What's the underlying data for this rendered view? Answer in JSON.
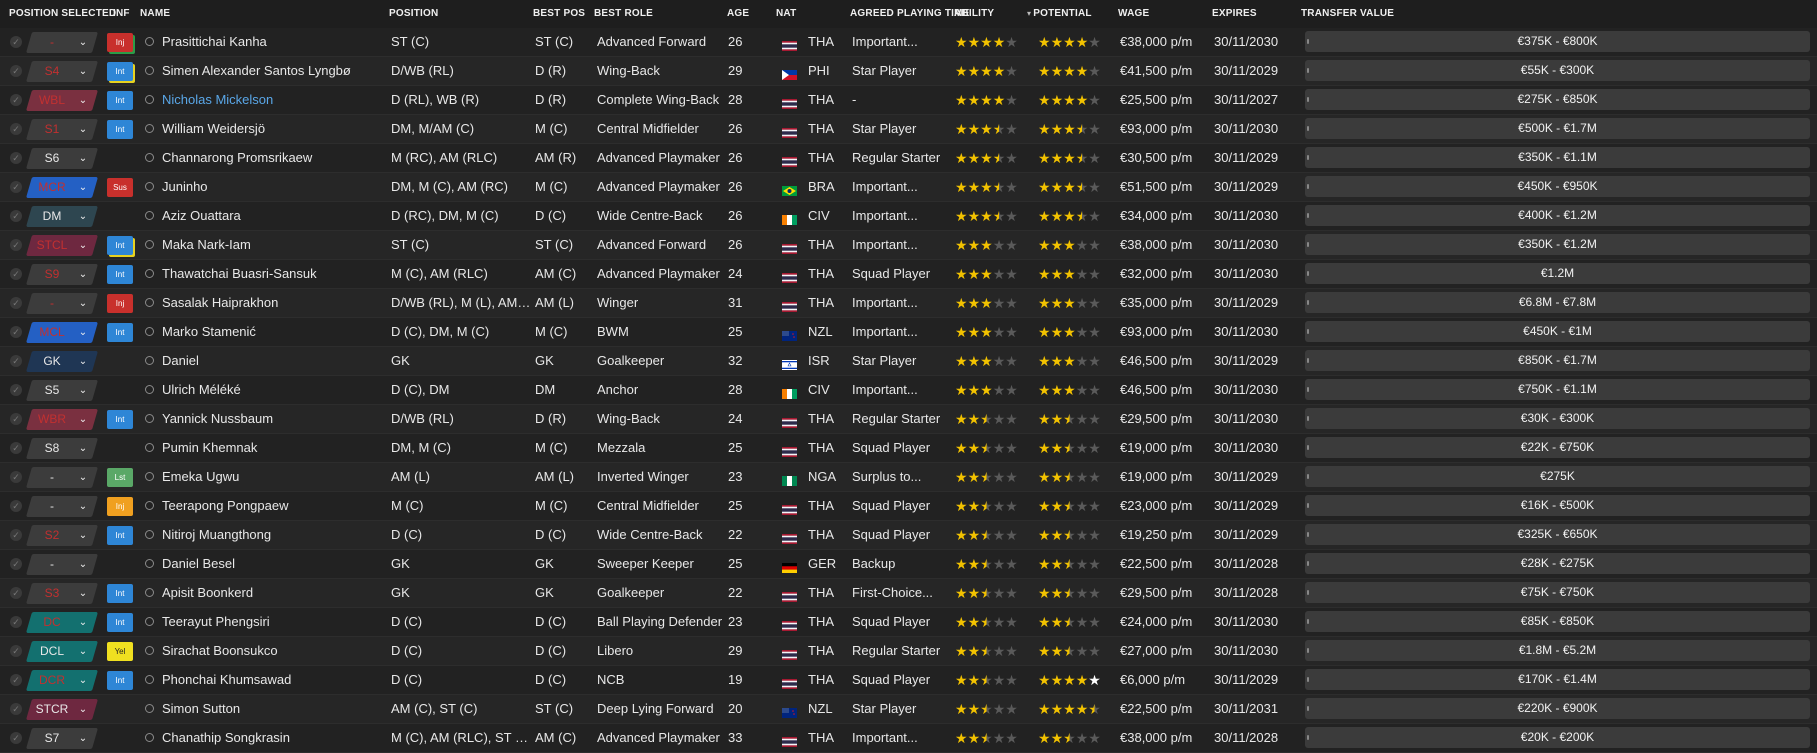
{
  "headers": {
    "position_selected": "POSITION SELECTED",
    "inf": "INF",
    "name": "NAME",
    "position": "POSITION",
    "best_pos": "BEST POS",
    "best_role": "BEST ROLE",
    "age": "AGE",
    "nat": "NAT",
    "agreed_playing_time": "AGREED PLAYING TIME",
    "ability": "ABILITY",
    "potential": "POTENTIAL",
    "wage": "WAGE",
    "expires": "EXPIRES",
    "transfer_value": "TRANSFER VALUE"
  },
  "sort": {
    "column": "potential",
    "direction": "descending",
    "indicator": "▾"
  },
  "colors": {
    "inj": "#c8302c",
    "int": "#2e86d6",
    "sus": "#c8302c",
    "lst": "#5aa867",
    "yel": "#f0e020",
    "inj_orange": "#f0a020",
    "gk": "#1f3654",
    "defence": "#13706f",
    "wing_back_red": "#7a3040",
    "midfield": "#3c4a52",
    "mid_blue": "#2460c4",
    "attack": "#7a2f4e",
    "striker": "#6e2840",
    "sub": "#3c3c3c",
    "star": "#f2c200"
  },
  "players": [
    {
      "sel": "-",
      "sel_color": "#3c3c3c",
      "sel_text_color": "#c23030",
      "badge": "Inj",
      "badge_color": "#c8302c",
      "badge_border": "#2a9d48",
      "name": "Prasittichai Kanha",
      "highlight": false,
      "position": "ST (C)",
      "best_pos": "ST (C)",
      "best_role": "Advanced Forward",
      "age": "26",
      "nat": "THA",
      "flag": "tha",
      "apt": "Important...",
      "ability": 4,
      "potential": 4,
      "wage": "€38,000 p/m",
      "expires": "30/11/2030",
      "tv": "€375K - €800K"
    },
    {
      "sel": "S4",
      "sel_color": "#3c3c3c",
      "sel_text_color": "#c23030",
      "badge": "Int",
      "badge_color": "#2e86d6",
      "badge_border": "#e8d21f",
      "name": "Simen Alexander Santos Lyngbø",
      "highlight": false,
      "position": "D/WB (RL)",
      "best_pos": "D (R)",
      "best_role": "Wing-Back",
      "age": "29",
      "nat": "PHI",
      "flag": "phi",
      "apt": "Star Player",
      "ability": 4,
      "potential": 4,
      "wage": "€41,500 p/m",
      "expires": "30/11/2029",
      "tv": "€55K - €300K"
    },
    {
      "sel": "WBL",
      "sel_color": "#7a3040",
      "sel_text_color": "#c23030",
      "badge": "Int",
      "badge_color": "#2e86d6",
      "badge_border": "",
      "name": "Nicholas Mickelson",
      "highlight": true,
      "position": "D (RL), WB (R)",
      "best_pos": "D (R)",
      "best_role": "Complete Wing-Back",
      "age": "28",
      "nat": "THA",
      "flag": "tha",
      "apt": "-",
      "ability": 4,
      "potential": 4,
      "wage": "€25,500 p/m",
      "expires": "30/11/2027",
      "tv": "€275K - €850K"
    },
    {
      "sel": "S1",
      "sel_color": "#3c3c3c",
      "sel_text_color": "#c23030",
      "badge": "Int",
      "badge_color": "#2e86d6",
      "badge_border": "",
      "name": "William Weidersjö",
      "highlight": false,
      "position": "DM, M/AM (C)",
      "best_pos": "M (C)",
      "best_role": "Central Midfielder",
      "age": "26",
      "nat": "THA",
      "flag": "tha",
      "apt": "Star Player",
      "ability": 3.5,
      "potential": 3.5,
      "wage": "€93,000 p/m",
      "expires": "30/11/2030",
      "tv": "€500K - €1.7M"
    },
    {
      "sel": "S6",
      "sel_color": "#3c3c3c",
      "sel_text_color": "#e8e8e8",
      "badge": "",
      "badge_color": "",
      "badge_border": "",
      "name": "Channarong Promsrikaew",
      "highlight": false,
      "position": "M (RC), AM (RLC)",
      "best_pos": "AM (R)",
      "best_role": "Advanced Playmaker",
      "age": "26",
      "nat": "THA",
      "flag": "tha",
      "apt": "Regular Starter",
      "ability": 3.5,
      "potential": 3.5,
      "wage": "€30,500 p/m",
      "expires": "30/11/2029",
      "tv": "€350K - €1.1M"
    },
    {
      "sel": "MCR",
      "sel_color": "#2460c4",
      "sel_text_color": "#c23030",
      "badge": "Sus",
      "badge_color": "#c8302c",
      "badge_border": "",
      "name": "Juninho",
      "highlight": false,
      "position": "DM, M (C), AM (RC)",
      "best_pos": "M (C)",
      "best_role": "Advanced Playmaker",
      "age": "26",
      "nat": "BRA",
      "flag": "bra",
      "apt": "Important...",
      "ability": 3.5,
      "potential": 3.5,
      "wage": "€51,500 p/m",
      "expires": "30/11/2029",
      "tv": "€450K - €950K"
    },
    {
      "sel": "DM",
      "sel_color": "#2e4650",
      "sel_text_color": "#e8e8e8",
      "badge": "",
      "badge_color": "",
      "badge_border": "",
      "name": "Aziz Ouattara",
      "highlight": false,
      "position": "D (RC), DM, M (C)",
      "best_pos": "D (C)",
      "best_role": "Wide Centre-Back",
      "age": "26",
      "nat": "CIV",
      "flag": "civ",
      "apt": "Important...",
      "ability": 3.5,
      "potential": 3.5,
      "wage": "€34,000 p/m",
      "expires": "30/11/2030",
      "tv": "€400K - €1.2M"
    },
    {
      "sel": "STCL",
      "sel_color": "#6e2840",
      "sel_text_color": "#c23030",
      "badge": "Int",
      "badge_color": "#2e86d6",
      "badge_border": "#e8d21f",
      "name": "Maka Nark-Iam",
      "highlight": false,
      "position": "ST (C)",
      "best_pos": "ST (C)",
      "best_role": "Advanced Forward",
      "age": "26",
      "nat": "THA",
      "flag": "tha",
      "apt": "Important...",
      "ability": 3,
      "potential": 3,
      "wage": "€38,000 p/m",
      "expires": "30/11/2030",
      "tv": "€350K - €1.2M"
    },
    {
      "sel": "S9",
      "sel_color": "#3c3c3c",
      "sel_text_color": "#c23030",
      "badge": "Int",
      "badge_color": "#2e86d6",
      "badge_border": "",
      "name": "Thawatchai Buasri-Sansuk",
      "highlight": false,
      "position": "M (C), AM (RLC)",
      "best_pos": "AM (C)",
      "best_role": "Advanced Playmaker",
      "age": "24",
      "nat": "THA",
      "flag": "tha",
      "apt": "Squad Player",
      "ability": 3,
      "potential": 3,
      "wage": "€32,000 p/m",
      "expires": "30/11/2030",
      "tv": "€1.2M"
    },
    {
      "sel": "-",
      "sel_color": "#3c3c3c",
      "sel_text_color": "#c23030",
      "badge": "Inj",
      "badge_color": "#c8302c",
      "badge_border": "",
      "name": "Sasalak Haiprakhon",
      "highlight": false,
      "position": "D/WB (RL), M (L), AM (R...",
      "best_pos": "AM (L)",
      "best_role": "Winger",
      "age": "31",
      "nat": "THA",
      "flag": "tha",
      "apt": "Important...",
      "ability": 3,
      "potential": 3,
      "wage": "€35,000 p/m",
      "expires": "30/11/2029",
      "tv": "€6.8M - €7.8M"
    },
    {
      "sel": "MCL",
      "sel_color": "#2460c4",
      "sel_text_color": "#c23030",
      "badge": "Int",
      "badge_color": "#2e86d6",
      "badge_border": "",
      "name": "Marko Stamenić",
      "highlight": false,
      "position": "D (C), DM, M (C)",
      "best_pos": "M (C)",
      "best_role": "BWM",
      "age": "25",
      "nat": "NZL",
      "flag": "nzl",
      "apt": "Important...",
      "ability": 3,
      "potential": 3,
      "wage": "€93,000 p/m",
      "expires": "30/11/2030",
      "tv": "€450K - €1M"
    },
    {
      "sel": "GK",
      "sel_color": "#1f3654",
      "sel_text_color": "#e8e8e8",
      "badge": "",
      "badge_color": "",
      "badge_border": "",
      "name": "Daniel",
      "highlight": false,
      "position": "GK",
      "best_pos": "GK",
      "best_role": "Goalkeeper",
      "age": "32",
      "nat": "ISR",
      "flag": "isr",
      "apt": "Star Player",
      "ability": 3,
      "potential": 3,
      "wage": "€46,500 p/m",
      "expires": "30/11/2029",
      "tv": "€850K - €1.7M"
    },
    {
      "sel": "S5",
      "sel_color": "#3c3c3c",
      "sel_text_color": "#e8e8e8",
      "badge": "",
      "badge_color": "",
      "badge_border": "",
      "name": "Ulrich Méléké",
      "highlight": false,
      "position": "D (C), DM",
      "best_pos": "DM",
      "best_role": "Anchor",
      "age": "28",
      "nat": "CIV",
      "flag": "civ",
      "apt": "Important...",
      "ability": 3,
      "potential": 3,
      "wage": "€46,500 p/m",
      "expires": "30/11/2030",
      "tv": "€750K - €1.1M"
    },
    {
      "sel": "WBR",
      "sel_color": "#7a3040",
      "sel_text_color": "#c23030",
      "badge": "Int",
      "badge_color": "#2e86d6",
      "badge_border": "",
      "name": "Yannick Nussbaum",
      "highlight": false,
      "position": "D/WB (RL)",
      "best_pos": "D (R)",
      "best_role": "Wing-Back",
      "age": "24",
      "nat": "THA",
      "flag": "tha",
      "apt": "Regular Starter",
      "ability": 2.5,
      "potential": 2.5,
      "wage": "€29,500 p/m",
      "expires": "30/11/2030",
      "tv": "€30K - €300K"
    },
    {
      "sel": "S8",
      "sel_color": "#3c3c3c",
      "sel_text_color": "#e8e8e8",
      "badge": "",
      "badge_color": "",
      "badge_border": "",
      "name": "Pumin Khemnak",
      "highlight": false,
      "position": "DM, M (C)",
      "best_pos": "M (C)",
      "best_role": "Mezzala",
      "age": "25",
      "nat": "THA",
      "flag": "tha",
      "apt": "Squad Player",
      "ability": 2.5,
      "potential": 2.5,
      "wage": "€19,000 p/m",
      "expires": "30/11/2030",
      "tv": "€22K - €750K"
    },
    {
      "sel": "-",
      "sel_color": "#3c3c3c",
      "sel_text_color": "#e8e8e8",
      "badge": "Lst",
      "badge_color": "#5aa867",
      "badge_border": "",
      "name": "Emeka Ugwu",
      "highlight": false,
      "position": "AM (L)",
      "best_pos": "AM (L)",
      "best_role": "Inverted Winger",
      "age": "23",
      "nat": "NGA",
      "flag": "nga",
      "apt": "Surplus to...",
      "ability": 2.5,
      "potential": 2.5,
      "wage": "€19,000 p/m",
      "expires": "30/11/2029",
      "tv": "€275K"
    },
    {
      "sel": "-",
      "sel_color": "#3c3c3c",
      "sel_text_color": "#e8e8e8",
      "badge": "Inj",
      "badge_color": "#f0a020",
      "badge_border": "",
      "name": "Teerapong Pongpaew",
      "highlight": false,
      "position": "M (C)",
      "best_pos": "M (C)",
      "best_role": "Central Midfielder",
      "age": "25",
      "nat": "THA",
      "flag": "tha",
      "apt": "Squad Player",
      "ability": 2.5,
      "potential": 2.5,
      "wage": "€23,000 p/m",
      "expires": "30/11/2029",
      "tv": "€16K - €500K"
    },
    {
      "sel": "S2",
      "sel_color": "#3c3c3c",
      "sel_text_color": "#c23030",
      "badge": "Int",
      "badge_color": "#2e86d6",
      "badge_border": "",
      "name": "Nitiroj Muangthong",
      "highlight": false,
      "position": "D (C)",
      "best_pos": "D (C)",
      "best_role": "Wide Centre-Back",
      "age": "22",
      "nat": "THA",
      "flag": "tha",
      "apt": "Squad Player",
      "ability": 2.5,
      "potential": 2.5,
      "wage": "€19,250 p/m",
      "expires": "30/11/2029",
      "tv": "€325K - €650K"
    },
    {
      "sel": "-",
      "sel_color": "#3c3c3c",
      "sel_text_color": "#e8e8e8",
      "badge": "",
      "badge_color": "",
      "badge_border": "",
      "name": "Daniel Besel",
      "highlight": false,
      "position": "GK",
      "best_pos": "GK",
      "best_role": "Sweeper Keeper",
      "age": "25",
      "nat": "GER",
      "flag": "ger",
      "apt": "Backup",
      "ability": 2.5,
      "potential": 2.5,
      "wage": "€22,500 p/m",
      "expires": "30/11/2028",
      "tv": "€28K - €275K"
    },
    {
      "sel": "S3",
      "sel_color": "#3c3c3c",
      "sel_text_color": "#c23030",
      "badge": "Int",
      "badge_color": "#2e86d6",
      "badge_border": "",
      "name": "Apisit Boonkerd",
      "highlight": false,
      "position": "GK",
      "best_pos": "GK",
      "best_role": "Goalkeeper",
      "age": "22",
      "nat": "THA",
      "flag": "tha",
      "apt": "First-Choice...",
      "ability": 2.5,
      "potential": 2.5,
      "wage": "€29,500 p/m",
      "expires": "30/11/2028",
      "tv": "€75K - €750K"
    },
    {
      "sel": "DC",
      "sel_color": "#13706f",
      "sel_text_color": "#c23030",
      "badge": "Int",
      "badge_color": "#2e86d6",
      "badge_border": "",
      "name": "Teerayut Phengsiri",
      "highlight": false,
      "position": "D (C)",
      "best_pos": "D (C)",
      "best_role": "Ball Playing Defender",
      "age": "23",
      "nat": "THA",
      "flag": "tha",
      "apt": "Squad Player",
      "ability": 2.5,
      "potential": 2.5,
      "wage": "€24,000 p/m",
      "expires": "30/11/2030",
      "tv": "€85K - €850K"
    },
    {
      "sel": "DCL",
      "sel_color": "#13706f",
      "sel_text_color": "#e8e8e8",
      "badge": "Yel",
      "badge_color": "#f0e020",
      "badge_border": "",
      "name": "Sirachat Boonsukco",
      "highlight": false,
      "position": "D (C)",
      "best_pos": "D (C)",
      "best_role": "Libero",
      "age": "29",
      "nat": "THA",
      "flag": "tha",
      "apt": "Regular Starter",
      "ability": 2.5,
      "potential": 2.5,
      "wage": "€27,000 p/m",
      "expires": "30/11/2030",
      "tv": "€1.8M - €5.2M"
    },
    {
      "sel": "DCR",
      "sel_color": "#13706f",
      "sel_text_color": "#c23030",
      "badge": "Int",
      "badge_color": "#2e86d6",
      "badge_border": "",
      "name": "Phonchai Khumsawad",
      "highlight": false,
      "position": "D (C)",
      "best_pos": "D (C)",
      "best_role": "NCB",
      "age": "19",
      "nat": "THA",
      "flag": "tha",
      "apt": "Squad Player",
      "ability": 2.5,
      "potential": 5,
      "potential_white_last": true,
      "wage": "€6,000 p/m",
      "expires": "30/11/2029",
      "tv": "€170K - €1.4M"
    },
    {
      "sel": "STCR",
      "sel_color": "#6e2840",
      "sel_text_color": "#e8e8e8",
      "badge": "",
      "badge_color": "",
      "badge_border": "",
      "name": "Simon Sutton",
      "highlight": false,
      "position": "AM (C), ST (C)",
      "best_pos": "ST (C)",
      "best_role": "Deep Lying Forward",
      "age": "20",
      "nat": "NZL",
      "flag": "nzl",
      "apt": "Star Player",
      "ability": 2.5,
      "potential": 4.5,
      "wage": "€22,500 p/m",
      "expires": "30/11/2031",
      "tv": "€220K - €900K"
    },
    {
      "sel": "S7",
      "sel_color": "#3c3c3c",
      "sel_text_color": "#e8e8e8",
      "badge": "",
      "badge_color": "",
      "badge_border": "",
      "name": "Chanathip Songkrasin",
      "highlight": false,
      "position": "M (C), AM (RLC), ST (C)",
      "best_pos": "AM (C)",
      "best_role": "Advanced Playmaker",
      "age": "33",
      "nat": "THA",
      "flag": "tha",
      "apt": "Important...",
      "ability": 2.5,
      "potential": 2.5,
      "wage": "€38,000 p/m",
      "expires": "30/11/2028",
      "tv": "€20K - €200K"
    }
  ]
}
